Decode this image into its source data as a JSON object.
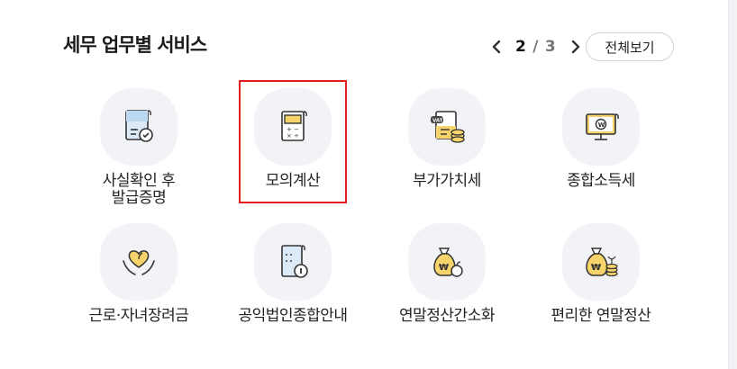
{
  "section": {
    "title": "세무 업무별 서비스",
    "pager": {
      "current": "2",
      "separator": "/",
      "total": "3"
    },
    "view_all_label": "전체보기"
  },
  "services": [
    {
      "label": "사실확인 후\n발급증명",
      "icon": "certificate-document-icon"
    },
    {
      "label": "모의계산",
      "icon": "calculator-icon"
    },
    {
      "label": "부가가치세",
      "icon": "vat-document-coins-icon"
    },
    {
      "label": "종합소득세",
      "icon": "monitor-won-icon"
    },
    {
      "label": "근로·자녀장려금",
      "icon": "hands-heart-icon"
    },
    {
      "label": "공익법인종합안내",
      "icon": "building-info-icon"
    },
    {
      "label": "연말정산간소화",
      "icon": "money-bag-apple-icon"
    },
    {
      "label": "편리한 연말정산",
      "icon": "money-bag-coins-icon"
    }
  ],
  "colors": {
    "highlight": "#e41e1e",
    "icon_bg": "#f1f3f7",
    "accent_yellow": "#f6d36b"
  }
}
